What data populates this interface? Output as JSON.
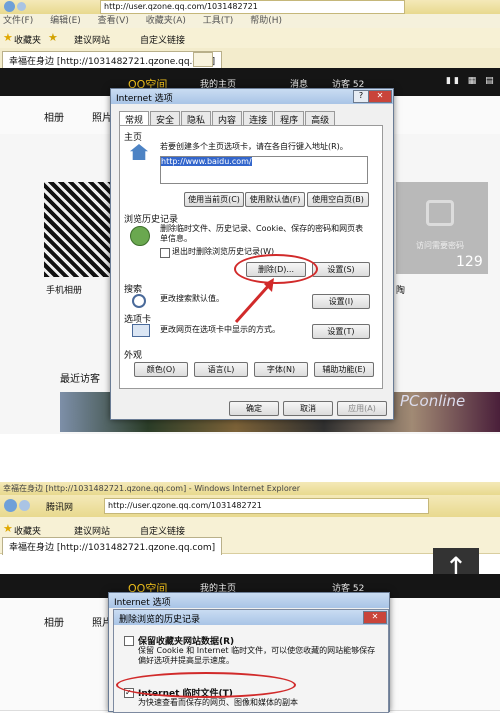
{
  "browser": {
    "menu": [
      "文件(F)",
      "编辑(E)",
      "查看(V)",
      "收藏夹(A)",
      "工具(T)",
      "帮助(H)"
    ],
    "url_tag": "腾讯网",
    "address_top": "http://user.qzone.qq.com/1031482721",
    "address_bottom": "http://user.qzone.qq.com/1031482721",
    "favorites_label": "收藏夹",
    "fav_suggest": "建议网站",
    "fav_custom": "自定义链接",
    "tab_title": "幸福在身边 [http://1031482721.qzone.qq.com]",
    "window_title_bottom": "幸福在身边 [http://1031482721.qzone.qq.com] - Windows Internet Explorer"
  },
  "qzone": {
    "logo": "QQ空间",
    "nav_home": "我的主页",
    "nav_msg": "消息",
    "visitors": "访客 52",
    "tab_album": "相册",
    "tab_photo": "照片",
    "mobile_album": "手机相册",
    "recent_visitors": "最近访客",
    "private_count": "129",
    "private_label": "访问需要密码",
    "misc_label": "陶",
    "watermark": "PConline"
  },
  "dialog_options": {
    "title": "Internet 选项",
    "tabs": [
      "常规",
      "安全",
      "隐私",
      "内容",
      "连接",
      "程序",
      "高级"
    ],
    "home_section": "主页",
    "home_desc": "若要创建多个主页选项卡，请在各自行键入地址(R)。",
    "home_url": "http://www.baidu.com/",
    "btn_use_current": "使用当前页(C)",
    "btn_use_default": "使用默认值(F)",
    "btn_use_blank": "使用空白页(B)",
    "history_section": "浏览历史记录",
    "history_desc": "删除临时文件、历史记录、Cookie、保存的密码和网页表单信息。",
    "history_checkbox": "退出时删除浏览历史记录(W)",
    "btn_delete": "删除(D)...",
    "btn_settings": "设置(S)",
    "search_section": "搜索",
    "search_desc": "更改搜索默认值。",
    "btn_search_settings": "设置(I)",
    "tabs_section": "选项卡",
    "tabs_desc": "更改网页在选项卡中显示的方式。",
    "btn_tabs_settings": "设置(T)",
    "appearance_section": "外观",
    "btn_colors": "颜色(O)",
    "btn_languages": "语言(L)",
    "btn_fonts": "字体(N)",
    "btn_accessibility": "辅助功能(E)",
    "btn_ok": "确定",
    "btn_cancel": "取消",
    "btn_apply": "应用(A)"
  },
  "dialog_delete": {
    "outer_title": "Internet 选项",
    "title": "删除浏览的历史记录",
    "opt1_title": "保留收藏夹网站数据(R)",
    "opt1_desc": "保留 Cookie 和 Internet 临时文件，可以使您收藏的网站能够保存偏好选项并提高显示速度。",
    "opt2_title": "Internet 临时文件(T)",
    "opt2_desc": "为快速查看而保存的网页、图像和媒体的副本"
  },
  "colors": {
    "accent_red": "#d12a2a",
    "qzone_top": "#151515"
  }
}
